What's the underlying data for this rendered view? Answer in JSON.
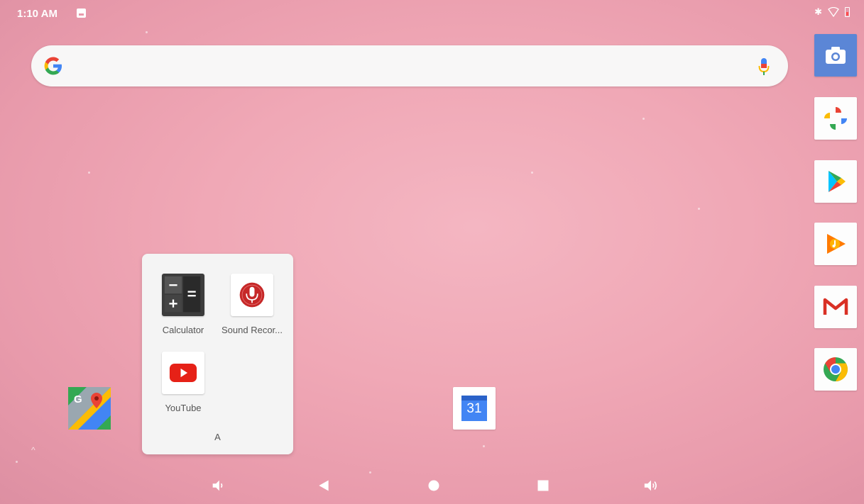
{
  "status_bar": {
    "time": "1:10 AM",
    "left_icons": [
      "image-notification-icon"
    ],
    "right_icons": [
      "bluetooth-icon",
      "wifi-icon",
      "battery-low-icon"
    ],
    "bluetooth_glyph": "✱"
  },
  "search_bar": {
    "logo": "G",
    "icons": [
      "google-logo-icon",
      "mic-icon"
    ]
  },
  "dock": {
    "apps": [
      "camera-icon",
      "google-photos-icon",
      "play-store-icon",
      "play-music-icon",
      "gmail-icon",
      "chrome-icon"
    ]
  },
  "folder": {
    "name": "A",
    "apps": [
      {
        "label": "Calculator",
        "icon": "calculator-icon"
      },
      {
        "label": "Sound Recor...",
        "icon": "sound-recorder-icon"
      },
      {
        "label": "YouTube",
        "icon": "youtube-icon"
      }
    ]
  },
  "desktop": {
    "maps_icon": "google-maps-icon",
    "calendar_icon": "calendar-icon",
    "calendar_day": "31",
    "swipe_up_glyph": "^"
  },
  "nav_bar": {
    "buttons": [
      "volume-down-icon",
      "back-icon",
      "home-icon",
      "recents-icon",
      "volume-up-icon"
    ]
  },
  "colors": {
    "wallpaper": "#f0a8b6",
    "folder_bg": "#f4f4f4",
    "youtube_red": "#e62117",
    "google_blue": "#4285f4"
  }
}
